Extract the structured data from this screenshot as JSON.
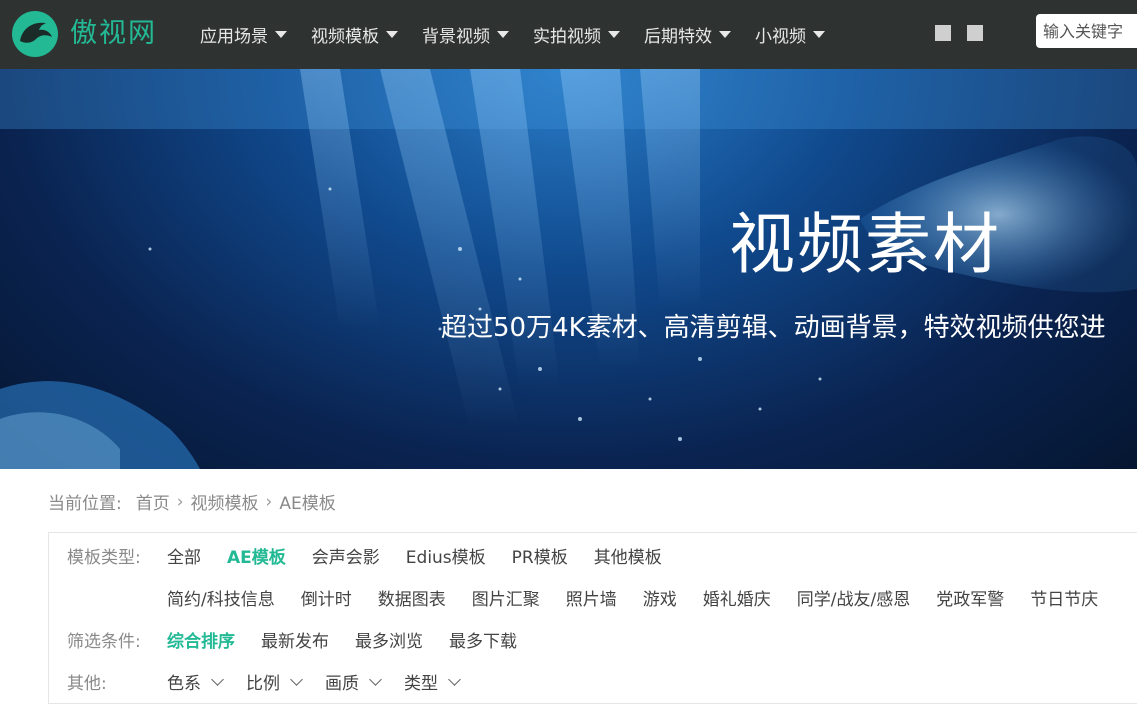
{
  "header": {
    "logo_text": "傲视网",
    "nav": [
      {
        "label": "应用场景"
      },
      {
        "label": "视频模板"
      },
      {
        "label": "背景视频"
      },
      {
        "label": "实拍视频"
      },
      {
        "label": "后期特效"
      },
      {
        "label": "小视频"
      }
    ],
    "search_placeholder": "输入关键字"
  },
  "banner": {
    "title": "视频素材",
    "subtitle": "超过50万4K素材、高清剪辑、动画背景，特效视频供您进"
  },
  "breadcrumb": {
    "prefix": "当前位置:",
    "items": [
      "首页",
      "视频模板",
      "AE模板"
    ]
  },
  "filters": {
    "type_label": "模板类型:",
    "types_row1": [
      "全部",
      "AE模板",
      "会声会影",
      "Edius模板",
      "PR模板",
      "其他模板"
    ],
    "types_row2": [
      "简约/科技信息",
      "倒计时",
      "数据图表",
      "图片汇聚",
      "照片墙",
      "游戏",
      "婚礼婚庆",
      "同学/战友/感恩",
      "党政军警",
      "节日节庆"
    ],
    "sort_label": "筛选条件:",
    "sorts": [
      "综合排序",
      "最新发布",
      "最多浏览",
      "最多下载"
    ],
    "other_label": "其他:",
    "others": [
      "色系",
      "比例",
      "画质",
      "类型"
    ]
  },
  "colors": {
    "accent": "#23b995",
    "header_bg": "#2e3332"
  }
}
